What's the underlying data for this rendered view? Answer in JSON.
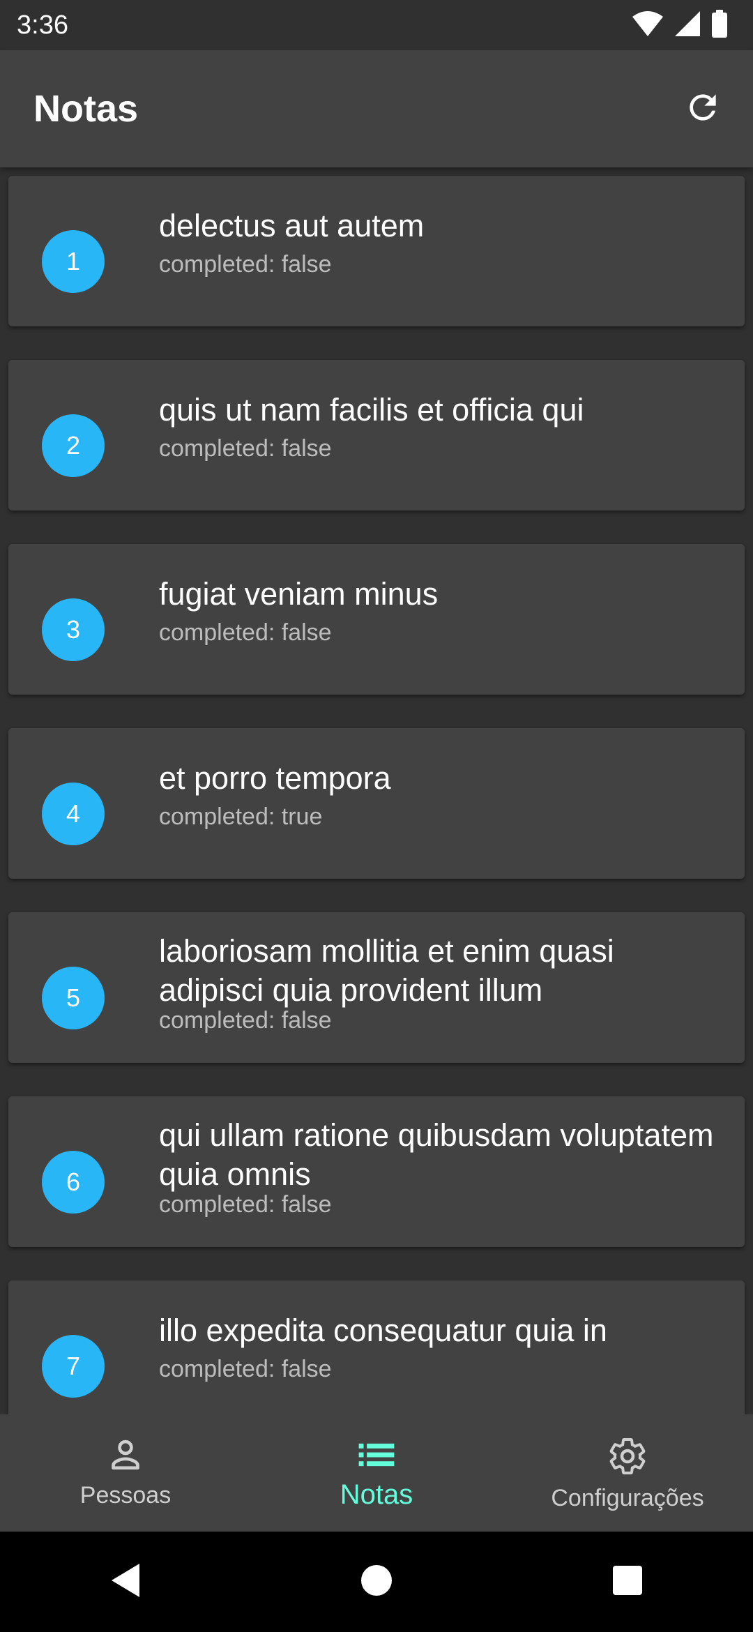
{
  "status_bar": {
    "time": "3:36",
    "icons": [
      "wifi-icon",
      "signal-icon",
      "battery-icon"
    ]
  },
  "app_bar": {
    "title": "Notas",
    "action_icon": "refresh-icon"
  },
  "notes": [
    {
      "id": "1",
      "title": "delectus aut autem",
      "status": "completed: false"
    },
    {
      "id": "2",
      "title": "quis ut nam facilis et officia qui",
      "status": "completed: false"
    },
    {
      "id": "3",
      "title": "fugiat veniam minus",
      "status": "completed: false"
    },
    {
      "id": "4",
      "title": "et porro tempora",
      "status": "completed: true"
    },
    {
      "id": "5",
      "title": "laboriosam mollitia et enim quasi adipisci quia provident illum",
      "status": "completed: false"
    },
    {
      "id": "6",
      "title": "qui ullam ratione quibusdam voluptatem quia omnis",
      "status": "completed: false"
    },
    {
      "id": "7",
      "title": "illo expedita consequatur quia in",
      "status": "completed: false"
    }
  ],
  "bottom_nav": {
    "items": [
      {
        "label": "Pessoas",
        "icon": "person-icon",
        "active": false
      },
      {
        "label": "Notas",
        "icon": "list-icon",
        "active": true
      },
      {
        "label": "Configurações",
        "icon": "gear-icon",
        "active": false
      }
    ]
  },
  "system_nav": {
    "icons": [
      "back-icon",
      "home-icon",
      "recents-icon"
    ]
  },
  "colors": {
    "background": "#303030",
    "surface": "#424242",
    "avatar": "#29b6f6",
    "accent": "#64ffda",
    "secondary_text": "#bdbdbd"
  }
}
